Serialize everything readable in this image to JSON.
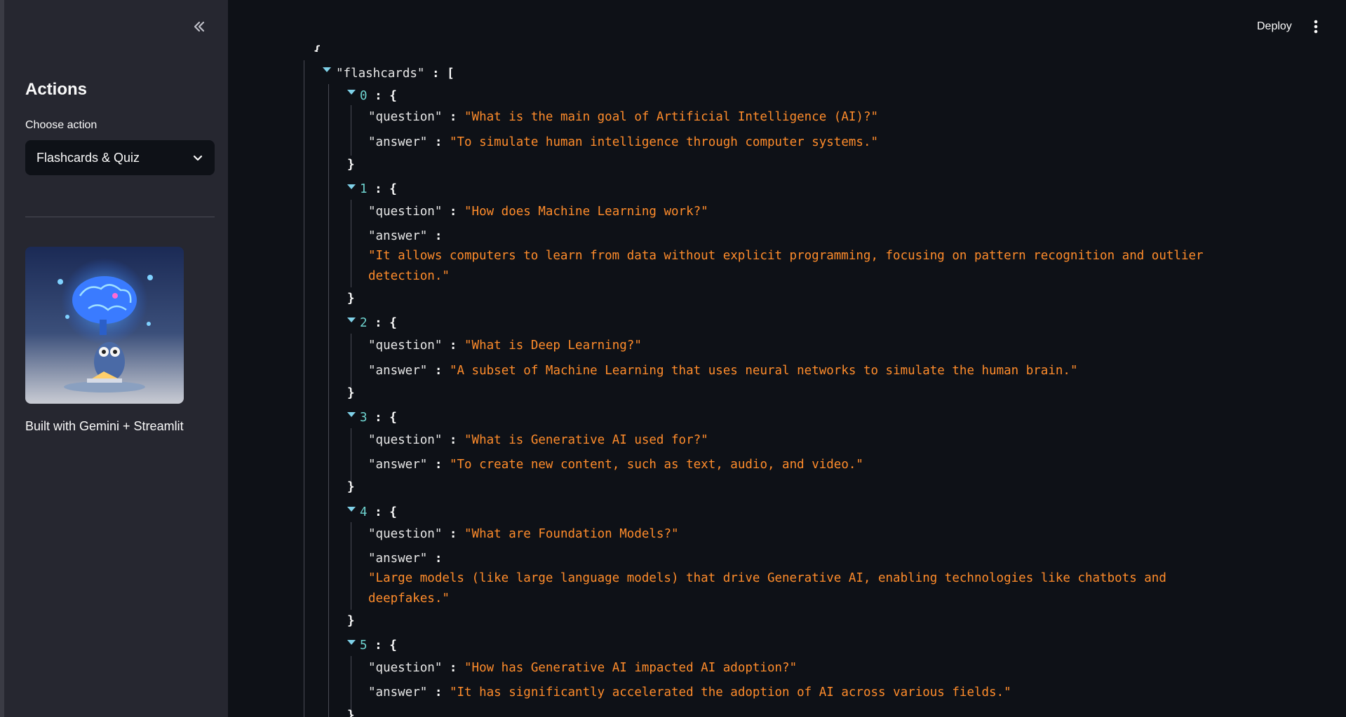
{
  "sidebar": {
    "title": "Actions",
    "choose_label": "Choose action",
    "selected_action": "Flashcards & Quiz",
    "caption": "Built with Gemini + Streamlit",
    "collapse_icon": "double-chevron-left-icon",
    "image_alt": "brain-and-owl-illustration"
  },
  "header": {
    "deploy_label": "Deploy",
    "menu_icon": "kebab-menu-icon"
  },
  "json_view": {
    "open_brace": "{",
    "root_key": "\"flashcards\"",
    "colon": ":",
    "open_bracket": "[",
    "open_obj": "{",
    "close_obj": "}",
    "question_key": "\"question\"",
    "answer_key": "\"answer\"",
    "items": [
      {
        "index": "0",
        "question": "\"What is the main goal of Artificial Intelligence (AI)?\"",
        "answer": "\"To simulate human intelligence through computer systems.\""
      },
      {
        "index": "1",
        "question": "\"How does Machine Learning work?\"",
        "answer_line1": "\"It allows computers to learn from data without explicit programming, focusing on pattern recognition and outlier",
        "answer_line2": "detection.\""
      },
      {
        "index": "2",
        "question": "\"What is Deep Learning?\"",
        "answer": "\"A subset of Machine Learning that uses neural networks to simulate the human brain.\""
      },
      {
        "index": "3",
        "question": "\"What is Generative AI used for?\"",
        "answer": "\"To create new content, such as text, audio, and video.\""
      },
      {
        "index": "4",
        "question": "\"What are Foundation Models?\"",
        "answer_line1": "\"Large models (like large language models) that drive Generative AI, enabling technologies like chatbots and",
        "answer_line2": "deepfakes.\""
      },
      {
        "index": "5",
        "question": "\"How has Generative AI impacted AI adoption?\"",
        "answer": "\"It has significantly accelerated the adoption of AI across various fields.\""
      }
    ]
  },
  "colors": {
    "background": "#0e1117",
    "sidebar": "#262730",
    "string": "#ff8c2b",
    "index": "#6ed3cf"
  }
}
